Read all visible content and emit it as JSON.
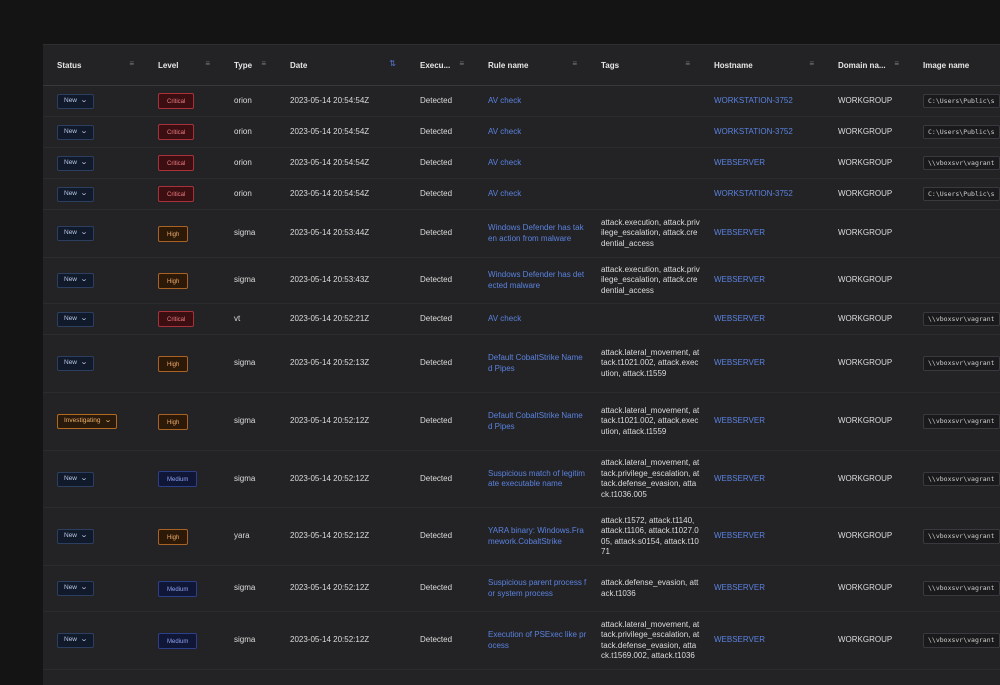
{
  "columns": [
    "Status",
    "Level",
    "Type",
    "Date",
    "Execu...",
    "Rule name",
    "Tags",
    "Hostname",
    "Domain na...",
    "Image name"
  ],
  "rows": [
    {
      "status": "New",
      "level": "Critical",
      "type": "orion",
      "date": "2023-05-14 20:54:54Z",
      "execution": "Detected",
      "rule": "AV check",
      "tags": "",
      "hostname": "WORKSTATION-3752",
      "domain": "WORKGROUP",
      "image": "C:\\Users\\Public\\s"
    },
    {
      "status": "New",
      "level": "Critical",
      "type": "orion",
      "date": "2023-05-14 20:54:54Z",
      "execution": "Detected",
      "rule": "AV check",
      "tags": "",
      "hostname": "WORKSTATION-3752",
      "domain": "WORKGROUP",
      "image": "C:\\Users\\Public\\s"
    },
    {
      "status": "New",
      "level": "Critical",
      "type": "orion",
      "date": "2023-05-14 20:54:54Z",
      "execution": "Detected",
      "rule": "AV check",
      "tags": "",
      "hostname": "WEBSERVER",
      "domain": "WORKGROUP",
      "image": "\\\\vboxsvr\\vagrant"
    },
    {
      "status": "New",
      "level": "Critical",
      "type": "orion",
      "date": "2023-05-14 20:54:54Z",
      "execution": "Detected",
      "rule": "AV check",
      "tags": "",
      "hostname": "WORKSTATION-3752",
      "domain": "WORKGROUP",
      "image": "C:\\Users\\Public\\s"
    },
    {
      "status": "New",
      "level": "High",
      "type": "sigma",
      "date": "2023-05-14 20:53:44Z",
      "execution": "Detected",
      "rule": "Windows Defender has taken action from malware",
      "tags": "attack.execution, attack.privilege_escalation, attack.credential_access",
      "hostname": "WEBSERVER",
      "domain": "WORKGROUP",
      "image": ""
    },
    {
      "status": "New",
      "level": "High",
      "type": "sigma",
      "date": "2023-05-14 20:53:43Z",
      "execution": "Detected",
      "rule": "Windows Defender has detected malware",
      "tags": "attack.execution, attack.privilege_escalation, attack.credential_access",
      "hostname": "WEBSERVER",
      "domain": "WORKGROUP",
      "image": ""
    },
    {
      "status": "New",
      "level": "Critical",
      "type": "vt",
      "date": "2023-05-14 20:52:21Z",
      "execution": "Detected",
      "rule": "AV check",
      "tags": "",
      "hostname": "WEBSERVER",
      "domain": "WORKGROUP",
      "image": "\\\\vboxsvr\\vagrant"
    },
    {
      "status": "New",
      "level": "High",
      "type": "sigma",
      "date": "2023-05-14 20:52:13Z",
      "execution": "Detected",
      "rule": "Default CobaltStrike Named Pipes",
      "tags": "attack.lateral_movement, attack.t1021.002, attack.execution, attack.t1559",
      "hostname": "WEBSERVER",
      "domain": "WORKGROUP",
      "image": "\\\\vboxsvr\\vagrant"
    },
    {
      "status": "Investigating",
      "level": "High",
      "type": "sigma",
      "date": "2023-05-14 20:52:12Z",
      "execution": "Detected",
      "rule": "Default CobaltStrike Named Pipes",
      "tags": "attack.lateral_movement, attack.t1021.002, attack.execution, attack.t1559",
      "hostname": "WEBSERVER",
      "domain": "WORKGROUP",
      "image": "\\\\vboxsvr\\vagrant"
    },
    {
      "status": "New",
      "level": "Medium",
      "type": "sigma",
      "date": "2023-05-14 20:52:12Z",
      "execution": "Detected",
      "rule": "Suspicious match of legitimate executable name",
      "tags": "attack.lateral_movement, attack.privilege_escalation, attack.defense_evasion, attack.t1036.005",
      "hostname": "WEBSERVER",
      "domain": "WORKGROUP",
      "image": "\\\\vboxsvr\\vagrant"
    },
    {
      "status": "New",
      "level": "High",
      "type": "yara",
      "date": "2023-05-14 20:52:12Z",
      "execution": "Detected",
      "rule": "YARA binary: Windows.Framework.CobaltStrike",
      "tags": "attack.t1572, attack.t1140, attack.t1106, attack.t1027.005, attack.s0154, attack.t1071",
      "hostname": "WEBSERVER",
      "domain": "WORKGROUP",
      "image": "\\\\vboxsvr\\vagrant"
    },
    {
      "status": "New",
      "level": "Medium",
      "type": "sigma",
      "date": "2023-05-14 20:52:12Z",
      "execution": "Detected",
      "rule": "Suspicious parent process for system process",
      "tags": "attack.defense_evasion, attack.t1036",
      "hostname": "WEBSERVER",
      "domain": "WORKGROUP",
      "image": "\\\\vboxsvr\\vagrant"
    },
    {
      "status": "New",
      "level": "Medium",
      "type": "sigma",
      "date": "2023-05-14 20:52:12Z",
      "execution": "Detected",
      "rule": "Execution of PSExec like process",
      "tags": "attack.lateral_movement, attack.privilege_escalation, attack.defense_evasion, attack.t1569.002, attack.t1036",
      "hostname": "WEBSERVER",
      "domain": "WORKGROUP",
      "image": "\\\\vboxsvr\\vagrant"
    }
  ],
  "filter_icon": "filter-icon",
  "sort_icon": "sort-icon",
  "chevron_icon": "chevron-down-icon",
  "colors": {
    "critical": "#a8323b",
    "high": "#a86324",
    "medium": "#2e3f8a",
    "link": "#5a82e0",
    "investigating": "#b26a22"
  }
}
